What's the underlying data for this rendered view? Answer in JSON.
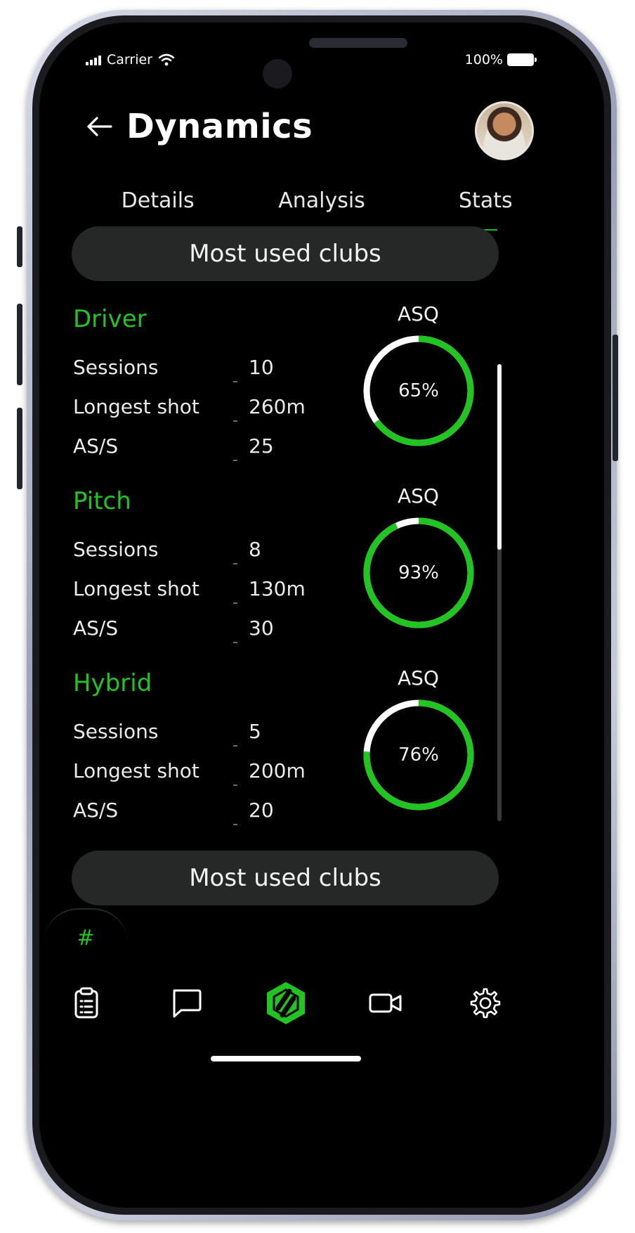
{
  "status_bar": {
    "carrier": "Carrier",
    "battery": "100%"
  },
  "header": {
    "title": "Dynamics"
  },
  "tabs": [
    {
      "label": "Details",
      "active": false
    },
    {
      "label": "Analysis",
      "active": false
    },
    {
      "label": "Stats",
      "active": true
    }
  ],
  "sections": {
    "top_label": "Most used clubs",
    "bottom_label": "Most used clubs"
  },
  "clubs": [
    {
      "name": "Driver",
      "asq_label": "ASQ",
      "asq_value": "65%",
      "asq_fraction": 0.65,
      "stats": [
        {
          "label": "Sessions",
          "value": "10"
        },
        {
          "label": "Longest shot",
          "value": "260m"
        },
        {
          "label": "AS/S",
          "value": "25"
        }
      ]
    },
    {
      "name": "Pitch",
      "asq_label": "ASQ",
      "asq_value": "93%",
      "asq_fraction": 0.93,
      "stats": [
        {
          "label": "Sessions",
          "value": "8"
        },
        {
          "label": "Longest shot",
          "value": "130m"
        },
        {
          "label": "AS/S",
          "value": "30"
        }
      ]
    },
    {
      "name": "Hybrid",
      "asq_label": "ASQ",
      "asq_value": "76%",
      "asq_fraction": 0.76,
      "stats": [
        {
          "label": "Sessions",
          "value": "5"
        },
        {
          "label": "Longest shot",
          "value": "200m"
        },
        {
          "label": "AS/S",
          "value": "20"
        }
      ]
    }
  ],
  "hash_tab": {
    "label": "#"
  },
  "nav": {
    "items": [
      {
        "icon": "clipboard-icon"
      },
      {
        "icon": "chat-icon"
      },
      {
        "icon": "logo-icon"
      },
      {
        "icon": "video-camera-icon"
      },
      {
        "icon": "settings-gear-icon"
      }
    ]
  },
  "colors": {
    "accent": "#22c422",
    "background": "#000000",
    "pill": "#262827"
  }
}
